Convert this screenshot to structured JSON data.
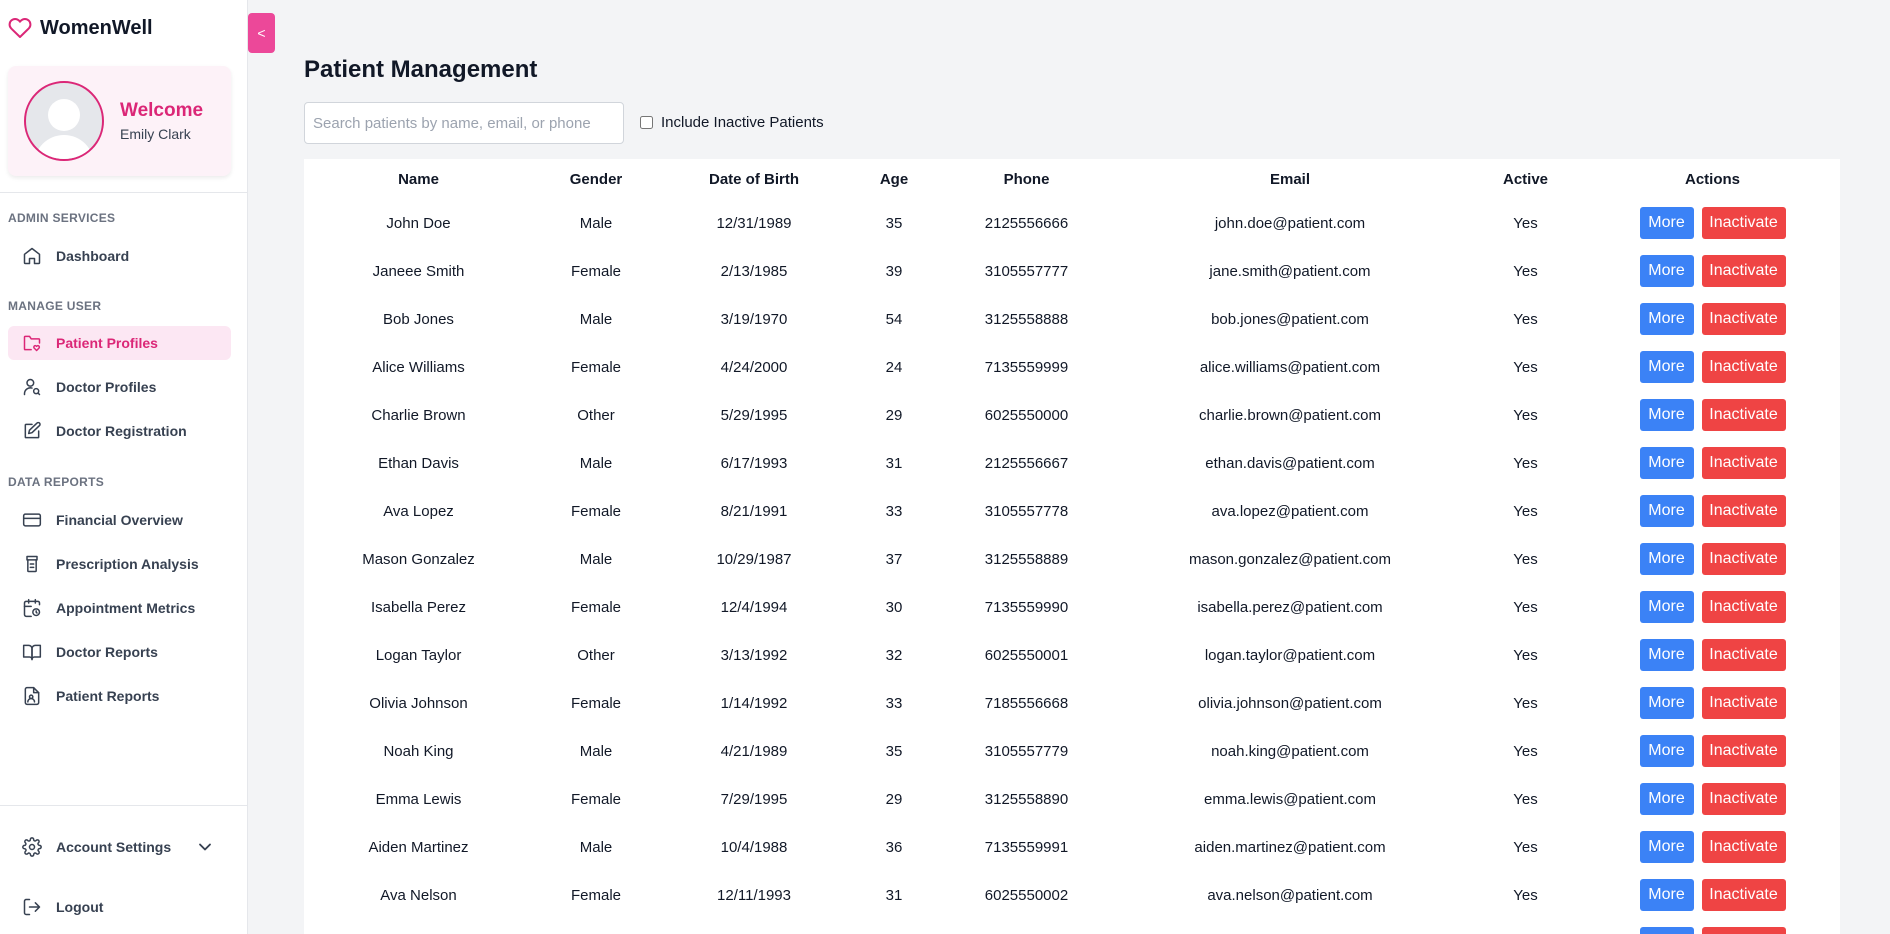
{
  "brand": {
    "name": "WomenWell"
  },
  "user": {
    "welcome": "Welcome",
    "name": "Emily Clark"
  },
  "sidebar": {
    "sections": [
      {
        "label": "ADMIN SERVICES"
      },
      {
        "label": "MANAGE USER"
      },
      {
        "label": "DATA REPORTS"
      }
    ],
    "items": [
      {
        "label": "Dashboard",
        "icon": "home-icon"
      },
      {
        "label": "Patient Profiles",
        "icon": "folder-heart-icon",
        "active": true
      },
      {
        "label": "Doctor Profiles",
        "icon": "user-search-icon"
      },
      {
        "label": "Doctor Registration",
        "icon": "edit-icon"
      },
      {
        "label": "Financial Overview",
        "icon": "credit-card-icon"
      },
      {
        "label": "Prescription Analysis",
        "icon": "pill-bottle-icon"
      },
      {
        "label": "Appointment Metrics",
        "icon": "calendar-clock-icon"
      },
      {
        "label": "Doctor Reports",
        "icon": "book-open-icon"
      },
      {
        "label": "Patient Reports",
        "icon": "file-user-icon"
      }
    ],
    "account_settings": "Account Settings",
    "logout": "Logout",
    "collapse_label": "<"
  },
  "main": {
    "title": "Patient Management",
    "search_placeholder": "Search patients by name, email, or phone",
    "include_inactive": "Include Inactive Patients",
    "columns": [
      "Name",
      "Gender",
      "Date of Birth",
      "Age",
      "Phone",
      "Email",
      "Active",
      "Actions"
    ],
    "more_label": "More",
    "inactivate_label": "Inactivate",
    "rows": [
      [
        "John Doe",
        "Male",
        "12/31/1989",
        "35",
        "2125556666",
        "john.doe@patient.com",
        "Yes"
      ],
      [
        "Janeee Smith",
        "Female",
        "2/13/1985",
        "39",
        "3105557777",
        "jane.smith@patient.com",
        "Yes"
      ],
      [
        "Bob Jones",
        "Male",
        "3/19/1970",
        "54",
        "3125558888",
        "bob.jones@patient.com",
        "Yes"
      ],
      [
        "Alice Williams",
        "Female",
        "4/24/2000",
        "24",
        "7135559999",
        "alice.williams@patient.com",
        "Yes"
      ],
      [
        "Charlie Brown",
        "Other",
        "5/29/1995",
        "29",
        "6025550000",
        "charlie.brown@patient.com",
        "Yes"
      ],
      [
        "Ethan Davis",
        "Male",
        "6/17/1993",
        "31",
        "2125556667",
        "ethan.davis@patient.com",
        "Yes"
      ],
      [
        "Ava Lopez",
        "Female",
        "8/21/1991",
        "33",
        "3105557778",
        "ava.lopez@patient.com",
        "Yes"
      ],
      [
        "Mason Gonzalez",
        "Male",
        "10/29/1987",
        "37",
        "3125558889",
        "mason.gonzalez@patient.com",
        "Yes"
      ],
      [
        "Isabella Perez",
        "Female",
        "12/4/1994",
        "30",
        "7135559990",
        "isabella.perez@patient.com",
        "Yes"
      ],
      [
        "Logan Taylor",
        "Other",
        "3/13/1992",
        "32",
        "6025550001",
        "logan.taylor@patient.com",
        "Yes"
      ],
      [
        "Olivia Johnson",
        "Female",
        "1/14/1992",
        "33",
        "7185556668",
        "olivia.johnson@patient.com",
        "Yes"
      ],
      [
        "Noah King",
        "Male",
        "4/21/1989",
        "35",
        "3105557779",
        "noah.king@patient.com",
        "Yes"
      ],
      [
        "Emma Lewis",
        "Female",
        "7/29/1995",
        "29",
        "3125558890",
        "emma.lewis@patient.com",
        "Yes"
      ],
      [
        "Aiden Martinez",
        "Male",
        "10/4/1988",
        "36",
        "7135559991",
        "aiden.martinez@patient.com",
        "Yes"
      ],
      [
        "Ava Nelson",
        "Female",
        "12/11/1993",
        "31",
        "6025550002",
        "ava.nelson@patient.com",
        "Yes"
      ],
      [
        "",
        "",
        "",
        "",
        "",
        "",
        ""
      ]
    ]
  },
  "colors": {
    "brand_pink": "#db2777",
    "toggle_pink": "#ec4899",
    "more_blue": "#3b82f6",
    "inactivate_red": "#ef4444"
  }
}
